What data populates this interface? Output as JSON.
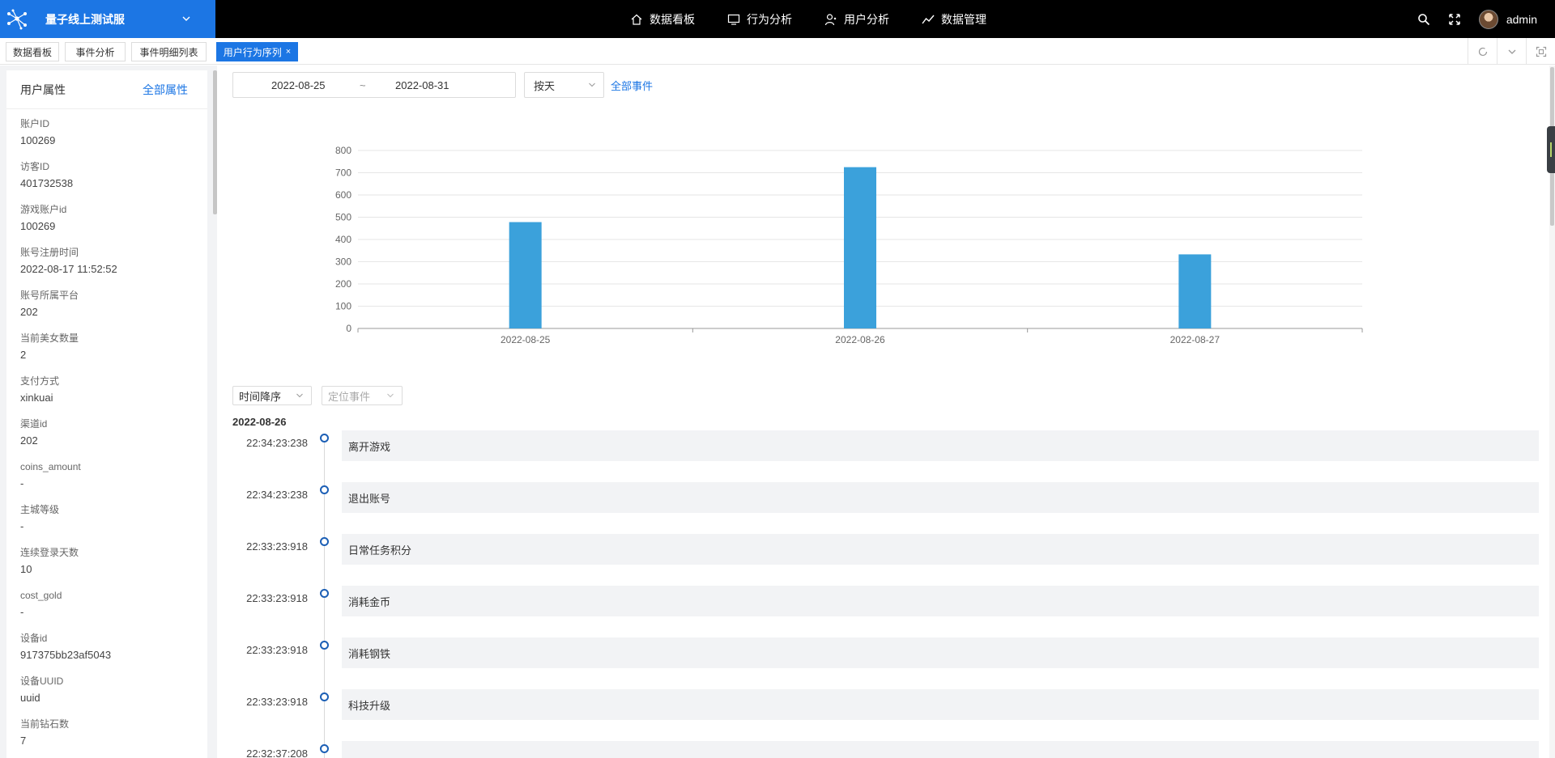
{
  "header": {
    "brand_name": "量子线上测试服",
    "nav": [
      {
        "label": "数据看板",
        "icon": "home-icon"
      },
      {
        "label": "行为分析",
        "icon": "monitor-icon"
      },
      {
        "label": "用户分析",
        "icon": "user-icon"
      },
      {
        "label": "数据管理",
        "icon": "trend-icon"
      }
    ],
    "username": "admin"
  },
  "tabs": [
    {
      "label": "数据看板"
    },
    {
      "label": "事件分析"
    },
    {
      "label": "事件明细列表"
    },
    {
      "label": "用户行为序列",
      "active": true,
      "close": "×"
    }
  ],
  "left_panel": {
    "title": "用户属性",
    "link": "全部属性",
    "attributes": [
      {
        "label": "账户ID",
        "value": "100269"
      },
      {
        "label": "访客ID",
        "value": "401732538"
      },
      {
        "label": "游戏账户id",
        "value": "100269"
      },
      {
        "label": "账号注册时间",
        "value": "2022-08-17 11:52:52"
      },
      {
        "label": "账号所属平台",
        "value": "202"
      },
      {
        "label": "当前美女数量",
        "value": "2"
      },
      {
        "label": "支付方式",
        "value": "xinkuai"
      },
      {
        "label": "渠道id",
        "value": "202"
      },
      {
        "label": "coins_amount",
        "value": "-"
      },
      {
        "label": "主城等级",
        "value": "-"
      },
      {
        "label": "连续登录天数",
        "value": "10"
      },
      {
        "label": "cost_gold",
        "value": "-"
      },
      {
        "label": "设备id",
        "value": "917375bb23af5043"
      },
      {
        "label": "设备UUID",
        "value": "uuid"
      },
      {
        "label": "当前钻石数",
        "value": "7"
      }
    ]
  },
  "filters": {
    "start_date": "2022-08-25",
    "separator": "~",
    "end_date": "2022-08-31",
    "granularity": "按天",
    "all_events": "全部事件"
  },
  "chart_data": {
    "type": "bar",
    "categories": [
      "2022-08-25",
      "2022-08-26",
      "2022-08-27"
    ],
    "values": [
      478,
      725,
      333
    ],
    "ylim": [
      0,
      800
    ],
    "yticks": [
      0,
      100,
      200,
      300,
      400,
      500,
      600,
      700,
      800
    ],
    "grid": true,
    "color": "#3ba1db"
  },
  "sequence": {
    "sort_label": "时间降序",
    "locate_placeholder": "定位事件",
    "day": "2022-08-26",
    "events": [
      {
        "time": "22:34:23:238",
        "name": "离开游戏"
      },
      {
        "time": "22:34:23:238",
        "name": "退出账号"
      },
      {
        "time": "22:33:23:918",
        "name": "日常任务积分"
      },
      {
        "time": "22:33:23:918",
        "name": "消耗金币"
      },
      {
        "time": "22:33:23:918",
        "name": "消耗钢铁"
      },
      {
        "time": "22:33:23:918",
        "name": "科技升级"
      },
      {
        "time": "22:32:37:208",
        "name": ""
      }
    ]
  }
}
